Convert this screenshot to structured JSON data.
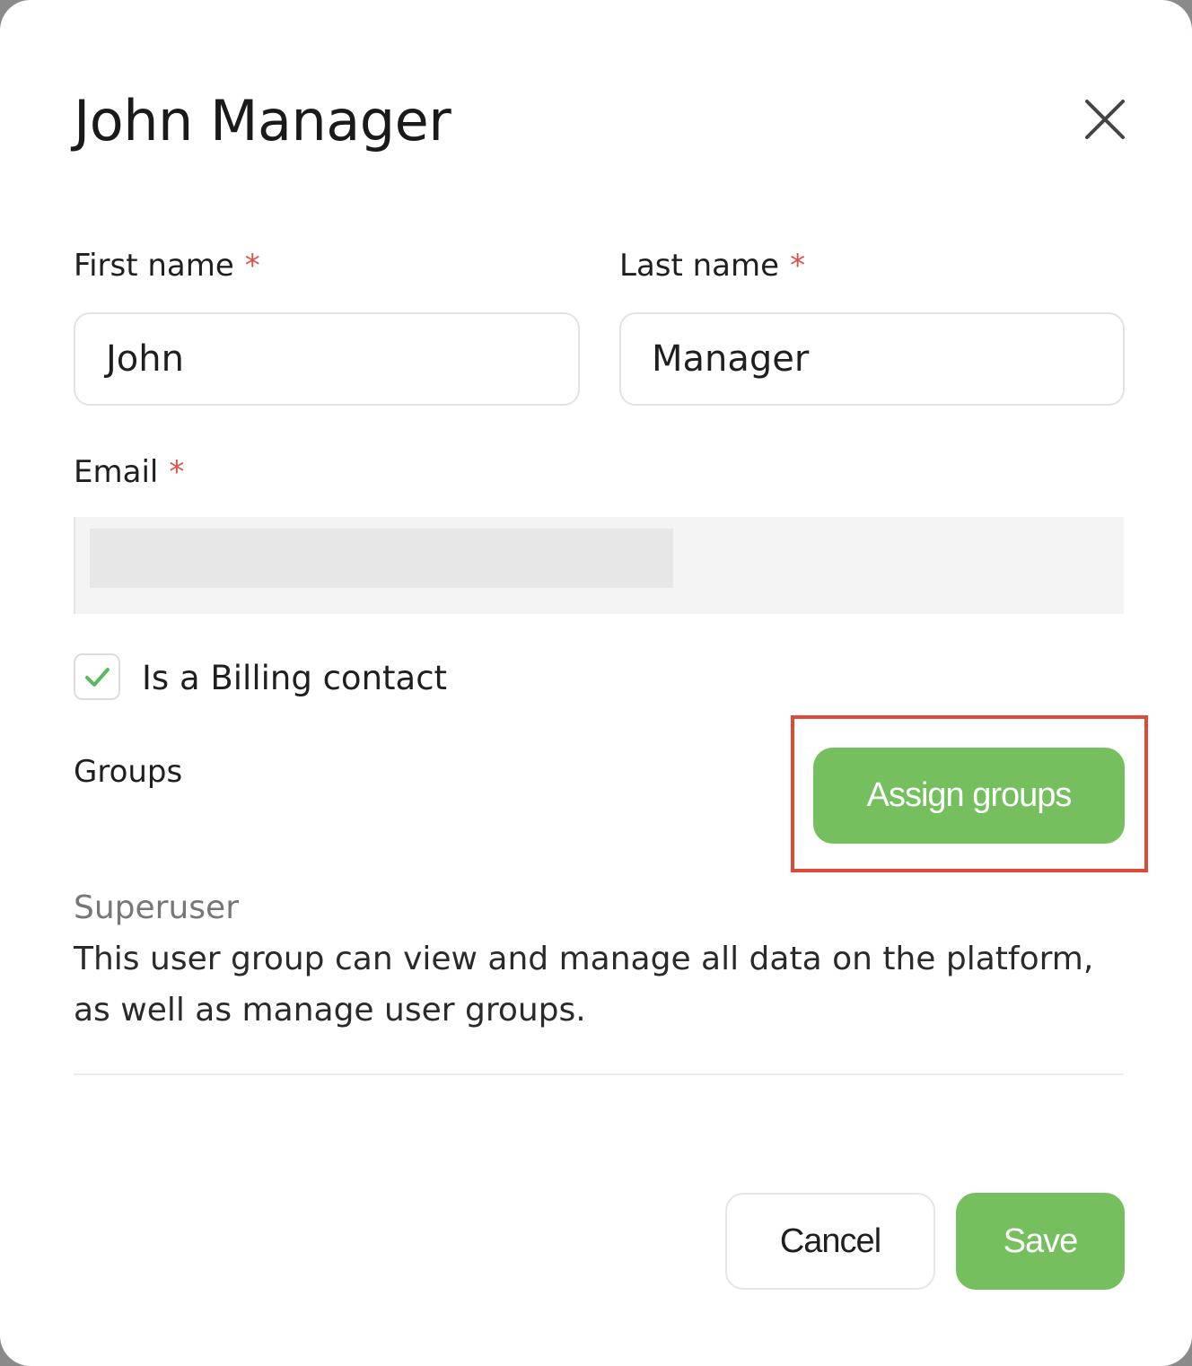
{
  "dialog": {
    "title": "John Manager",
    "close_icon": "close-icon"
  },
  "form": {
    "first_name": {
      "label": "First name",
      "required_mark": "*",
      "value": "John"
    },
    "last_name": {
      "label": "Last name",
      "required_mark": "*",
      "value": "Manager"
    },
    "email": {
      "label": "Email",
      "required_mark": "*",
      "value": ""
    },
    "billing_contact": {
      "label": "Is a Billing contact",
      "checked": true,
      "icon": "check-icon"
    }
  },
  "groups": {
    "heading": "Groups",
    "assign_button": "Assign groups",
    "items": [
      {
        "name": "Superuser",
        "description": "This user group can view and manage all data on the platform, as well as manage user groups."
      }
    ]
  },
  "footer": {
    "cancel_label": "Cancel",
    "save_label": "Save"
  },
  "colors": {
    "accent_green": "#75bf5e",
    "required_red": "#d9534f",
    "highlight_red": "#de4a37"
  }
}
